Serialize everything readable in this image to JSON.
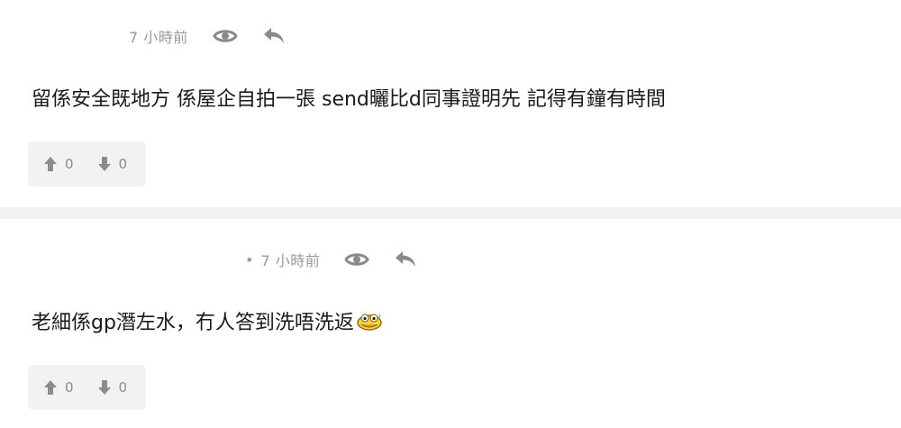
{
  "posts": [
    {
      "time": "7 小時前",
      "show_dot": false,
      "text": "留係安全既地方 係屋企自拍一張 send曬比d同事證明先 記得有鐘有時間",
      "votes": {
        "up": "0",
        "down": "0"
      },
      "emoji": null
    },
    {
      "dot": "•",
      "time": "7 小時前",
      "show_dot": true,
      "text": "老細係gp潛左水，冇人答到洗唔洗返",
      "votes": {
        "up": "0",
        "down": "0"
      },
      "emoji": "sweating-face-emoji"
    }
  ],
  "icons": {
    "eye": "eye-icon",
    "reply": "reply-arrow-icon",
    "upvote": "arrow-up-icon",
    "downvote": "arrow-down-icon"
  },
  "colors": {
    "meta_text": "#9a9a9a",
    "icon": "#8a8a8a",
    "vote_bg": "#f2f2f2",
    "separator": "#f2f2f2",
    "text": "#1a1a1a"
  }
}
